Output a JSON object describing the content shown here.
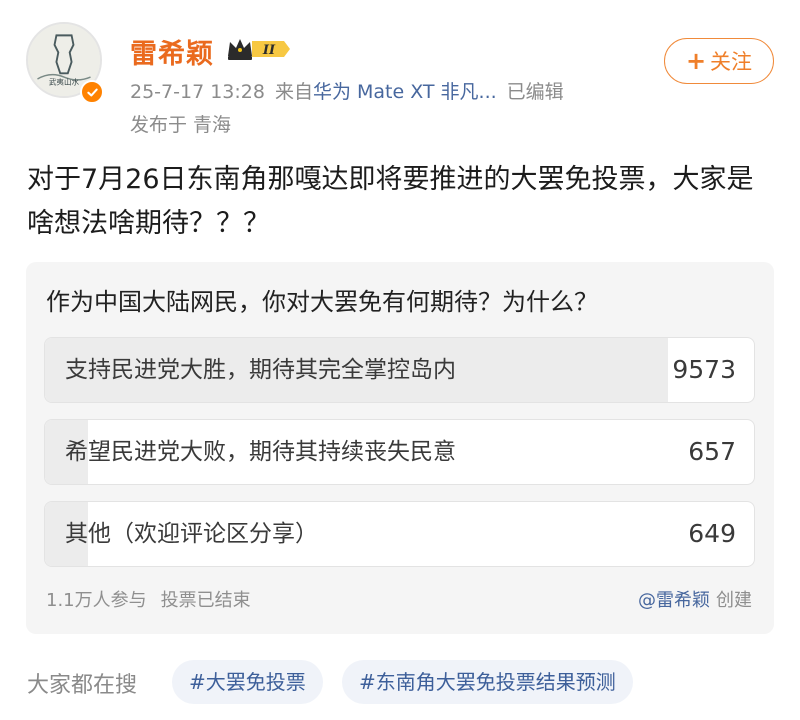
{
  "header": {
    "username": "雷希颖",
    "vip_level": "II",
    "timestamp": "25-7-17 13:28",
    "source_prefix": "来自",
    "device": "华为 Mate XT 非凡...",
    "edited": "已编辑",
    "location": "发布于 青海",
    "follow_label": "关注",
    "avatar_text": "武夷山水"
  },
  "post": {
    "text": "对于7月26日东南角那嘎达即将要推进的大罢免投票，大家是啥想法啥期待？？？"
  },
  "poll": {
    "question": "作为中国大陆网民，你对大罢免有何期待？为什么？",
    "options": [
      {
        "label": "支持民进党大胜，期待其完全掌控岛内",
        "count": "9573",
        "share": 0.878
      },
      {
        "label": "希望民进党大败，期待其持续丧失民意",
        "count": "657",
        "share": 0.06
      },
      {
        "label": "其他（欢迎评论区分享）",
        "count": "649",
        "share": 0.06
      }
    ],
    "participants": "1.1万人参与",
    "status": "投票已结束",
    "creator": "@雷希颖",
    "created_label": "创建"
  },
  "search": {
    "label": "大家都在搜",
    "tags": [
      "#大罢免投票",
      "#东南角大罢免投票结果预测"
    ]
  },
  "colors": {
    "username": "#ea6a1e",
    "link": "#47679e",
    "follow": "#ef7f2a",
    "verified": "#ff8200"
  }
}
